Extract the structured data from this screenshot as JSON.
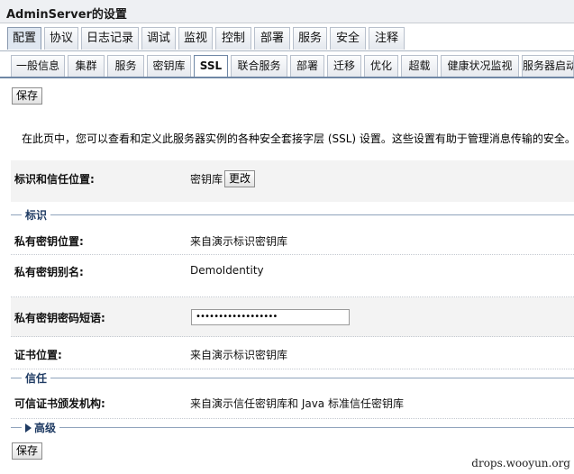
{
  "window": {
    "title": "AdminServer的设置"
  },
  "primary_tabs": [
    {
      "label": "配置",
      "active": true
    },
    {
      "label": "协议",
      "active": false
    },
    {
      "label": "日志记录",
      "active": false
    },
    {
      "label": "调试",
      "active": false
    },
    {
      "label": "监视",
      "active": false
    },
    {
      "label": "控制",
      "active": false
    },
    {
      "label": "部署",
      "active": false
    },
    {
      "label": "服务",
      "active": false
    },
    {
      "label": "安全",
      "active": false
    },
    {
      "label": "注释",
      "active": false
    }
  ],
  "secondary_tabs": [
    {
      "label": "一般信息",
      "active": false
    },
    {
      "label": "集群",
      "active": false
    },
    {
      "label": "服务",
      "active": false
    },
    {
      "label": "密钥库",
      "active": false
    },
    {
      "label": "SSL",
      "active": true
    },
    {
      "label": "联合服务",
      "active": false
    },
    {
      "label": "部署",
      "active": false
    },
    {
      "label": "迁移",
      "active": false
    },
    {
      "label": "优化",
      "active": false
    },
    {
      "label": "超载",
      "active": false
    },
    {
      "label": "健康状况监视",
      "active": false
    },
    {
      "label": "服务器启动",
      "active": false
    }
  ],
  "toolbar": {
    "save_label": "保存"
  },
  "description": "在此页中，您可以查看和定义此服务器实例的各种安全套接字层 (SSL) 设置。这些设置有助于管理消息传输的安全。",
  "identity_trust": {
    "label": "标识和信任位置:",
    "value": "密钥库",
    "change_label": "更改"
  },
  "identity_section": {
    "title": "标识",
    "private_key_location": {
      "label": "私有密钥位置:",
      "value": "来自演示标识密钥库"
    },
    "private_key_alias": {
      "label": "私有密钥别名:",
      "value": "DemoIdentity"
    },
    "private_key_passphrase": {
      "label": "私有密钥密码短语:",
      "value": "••••••••••••••••••"
    },
    "certificate_location": {
      "label": "证书位置:",
      "value": "来自演示标识密钥库"
    }
  },
  "trust_section": {
    "title": "信任",
    "trusted_ca": {
      "label": "可信证书颁发机构:",
      "value": "来自演示信任密钥库和 Java 标准信任密钥库"
    }
  },
  "advanced_section": {
    "title": "高级"
  },
  "watermark": "drops.wooyun.org"
}
